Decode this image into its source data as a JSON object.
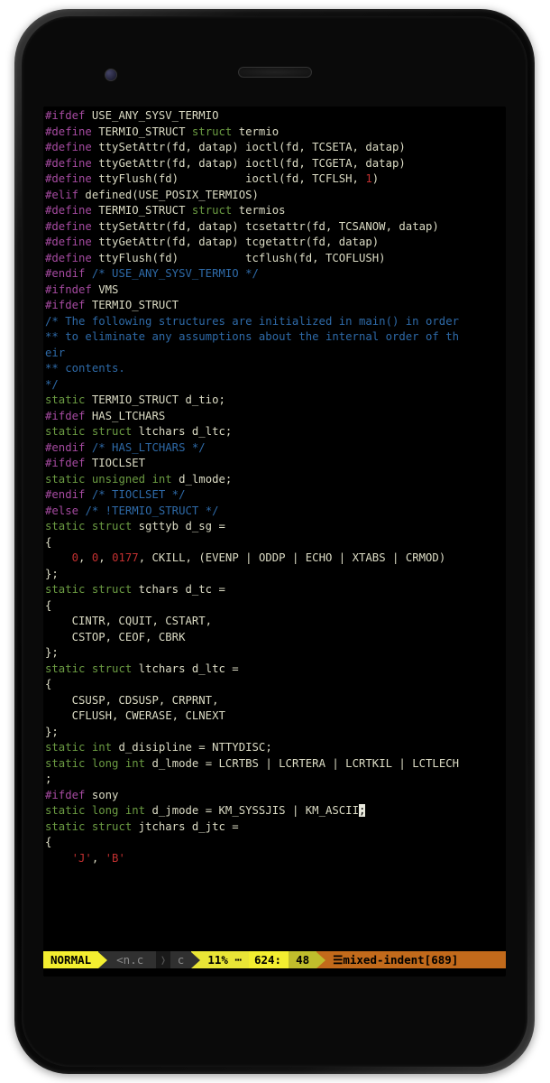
{
  "code_lines": [
    [
      [
        "pp",
        "#ifdef"
      ],
      [
        "id",
        " USE_ANY_SYSV_TERMIO"
      ]
    ],
    [
      [
        "pp",
        "#define"
      ],
      [
        "id",
        " TERMIO_STRUCT "
      ],
      [
        "kw",
        "struct"
      ],
      [
        "id",
        " termio"
      ]
    ],
    [
      [
        "pp",
        "#define"
      ],
      [
        "id",
        " ttySetAttr(fd, datap) ioctl(fd, TCSETA, datap)"
      ]
    ],
    [
      [
        "pp",
        "#define"
      ],
      [
        "id",
        " ttyGetAttr(fd, datap) ioctl(fd, TCGETA, datap)"
      ]
    ],
    [
      [
        "pp",
        "#define"
      ],
      [
        "id",
        " ttyFlush(fd)          ioctl(fd, TCFLSH, "
      ],
      [
        "num",
        "1"
      ],
      [
        "id",
        ")"
      ]
    ],
    [
      [
        "pp",
        "#elif"
      ],
      [
        "id",
        " defined(USE_POSIX_TERMIOS)"
      ]
    ],
    [
      [
        "pp",
        "#define"
      ],
      [
        "id",
        " TERMIO_STRUCT "
      ],
      [
        "kw",
        "struct"
      ],
      [
        "id",
        " termios"
      ]
    ],
    [
      [
        "pp",
        "#define"
      ],
      [
        "id",
        " ttySetAttr(fd, datap) tcsetattr(fd, TCSANOW, datap)"
      ]
    ],
    [
      [
        "pp",
        "#define"
      ],
      [
        "id",
        " ttyGetAttr(fd, datap) tcgetattr(fd, datap)"
      ]
    ],
    [
      [
        "pp",
        "#define"
      ],
      [
        "id",
        " ttyFlush(fd)          tcflush(fd, TCOFLUSH)"
      ]
    ],
    [
      [
        "pp",
        "#endif"
      ],
      [
        "id",
        " "
      ],
      [
        "cm",
        "/* USE_ANY_SYSV_TERMIO */"
      ]
    ],
    [
      [
        "id",
        ""
      ]
    ],
    [
      [
        "pp",
        "#ifndef"
      ],
      [
        "id",
        " VMS"
      ]
    ],
    [
      [
        "pp",
        "#ifdef"
      ],
      [
        "id",
        " TERMIO_STRUCT"
      ]
    ],
    [
      [
        "cm",
        "/* The following structures are initialized in main() in order"
      ]
    ],
    [
      [
        "cm",
        "** to eliminate any assumptions about the internal order of th"
      ]
    ],
    [
      [
        "cm",
        "eir"
      ]
    ],
    [
      [
        "cm",
        "** contents."
      ]
    ],
    [
      [
        "cm",
        "*/"
      ]
    ],
    [
      [
        "kw",
        "static"
      ],
      [
        "id",
        " TERMIO_STRUCT d_tio;"
      ]
    ],
    [
      [
        "id",
        ""
      ]
    ],
    [
      [
        "pp",
        "#ifdef"
      ],
      [
        "id",
        " HAS_LTCHARS"
      ]
    ],
    [
      [
        "kw",
        "static"
      ],
      [
        "id",
        " "
      ],
      [
        "kw",
        "struct"
      ],
      [
        "id",
        " ltchars d_ltc;"
      ]
    ],
    [
      [
        "pp",
        "#endif"
      ],
      [
        "id",
        " "
      ],
      [
        "cm",
        "/* HAS_LTCHARS */"
      ]
    ],
    [
      [
        "id",
        ""
      ]
    ],
    [
      [
        "pp",
        "#ifdef"
      ],
      [
        "id",
        " TIOCLSET"
      ]
    ],
    [
      [
        "kw",
        "static"
      ],
      [
        "id",
        " "
      ],
      [
        "kw",
        "unsigned"
      ],
      [
        "id",
        " "
      ],
      [
        "kw",
        "int"
      ],
      [
        "id",
        " d_lmode;"
      ]
    ],
    [
      [
        "pp",
        "#endif"
      ],
      [
        "id",
        " "
      ],
      [
        "cm",
        "/* TIOCLSET */"
      ]
    ],
    [
      [
        "id",
        ""
      ]
    ],
    [
      [
        "pp",
        "#else"
      ],
      [
        "id",
        " "
      ],
      [
        "cm",
        "/* !TERMIO_STRUCT */"
      ]
    ],
    [
      [
        "kw",
        "static"
      ],
      [
        "id",
        " "
      ],
      [
        "kw",
        "struct"
      ],
      [
        "id",
        " sgttyb d_sg ="
      ]
    ],
    [
      [
        "id",
        "{"
      ]
    ],
    [
      [
        "id",
        "    "
      ],
      [
        "num",
        "0"
      ],
      [
        "id",
        ", "
      ],
      [
        "num",
        "0"
      ],
      [
        "id",
        ", "
      ],
      [
        "num",
        "0177"
      ],
      [
        "id",
        ", CKILL, (EVENP | ODDP | ECHO | XTABS | CRMOD)"
      ]
    ],
    [
      [
        "id",
        "};"
      ]
    ],
    [
      [
        "kw",
        "static"
      ],
      [
        "id",
        " "
      ],
      [
        "kw",
        "struct"
      ],
      [
        "id",
        " tchars d_tc ="
      ]
    ],
    [
      [
        "id",
        "{"
      ]
    ],
    [
      [
        "id",
        "    CINTR, CQUIT, CSTART,"
      ]
    ],
    [
      [
        "id",
        "    CSTOP, CEOF, CBRK"
      ]
    ],
    [
      [
        "id",
        "};"
      ]
    ],
    [
      [
        "kw",
        "static"
      ],
      [
        "id",
        " "
      ],
      [
        "kw",
        "struct"
      ],
      [
        "id",
        " ltchars d_ltc ="
      ]
    ],
    [
      [
        "id",
        "{"
      ]
    ],
    [
      [
        "id",
        "    CSUSP, CDSUSP, CRPRNT,"
      ]
    ],
    [
      [
        "id",
        "    CFLUSH, CWERASE, CLNEXT"
      ]
    ],
    [
      [
        "id",
        "};"
      ]
    ],
    [
      [
        "kw",
        "static"
      ],
      [
        "id",
        " "
      ],
      [
        "kw",
        "int"
      ],
      [
        "id",
        " d_disipline = NTTYDISC;"
      ]
    ],
    [
      [
        "kw",
        "static"
      ],
      [
        "id",
        " "
      ],
      [
        "kw",
        "long"
      ],
      [
        "id",
        " "
      ],
      [
        "kw",
        "int"
      ],
      [
        "id",
        " d_lmode = LCRTBS | LCRTERA | LCRTKIL | LCTLECH"
      ]
    ],
    [
      [
        "id",
        ";"
      ]
    ],
    [
      [
        "pp",
        "#ifdef"
      ],
      [
        "id",
        " sony"
      ]
    ],
    [
      [
        "kw",
        "static"
      ],
      [
        "id",
        " "
      ],
      [
        "kw",
        "long"
      ],
      [
        "id",
        " "
      ],
      [
        "kw",
        "int"
      ],
      [
        "id",
        " d_jmode = KM_SYSSJIS | KM_ASCII"
      ],
      [
        "csr",
        ";"
      ]
    ],
    [
      [
        "kw",
        "static"
      ],
      [
        "id",
        " "
      ],
      [
        "kw",
        "struct"
      ],
      [
        "id",
        " jtchars d_jtc ="
      ]
    ],
    [
      [
        "id",
        "{"
      ]
    ],
    [
      [
        "id",
        "    "
      ],
      [
        "num",
        "'J'"
      ],
      [
        "id",
        ", "
      ],
      [
        "num",
        "'B'"
      ]
    ]
  ],
  "status": {
    "mode": " NORMAL ",
    "filename": "<n.c",
    "filetype": "c",
    "percent": "11% ┅",
    "line_label": " 624:",
    "col": " 48 ",
    "warning_icon": "☰",
    "warning": " mixed-indent[689]"
  }
}
